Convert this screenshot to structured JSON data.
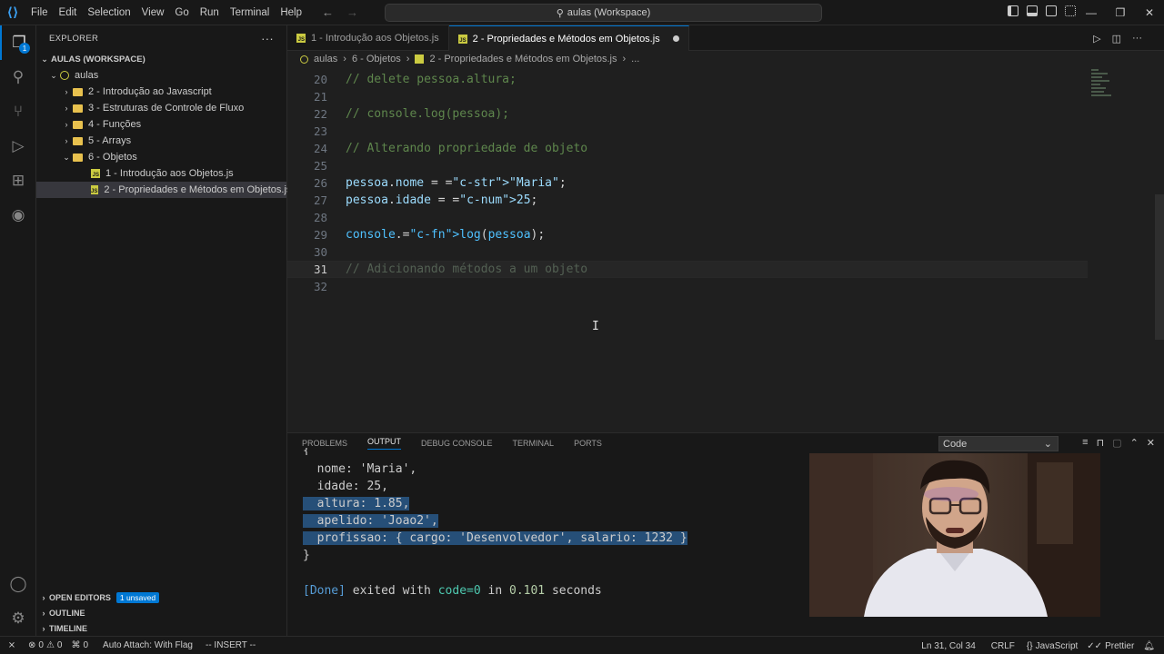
{
  "titlebar": {
    "menu": [
      "File",
      "Edit",
      "Selection",
      "View",
      "Go",
      "Run",
      "Terminal",
      "Help"
    ],
    "search_text": "aulas (Workspace)"
  },
  "sidebar": {
    "title": "EXPLORER",
    "more": "···",
    "workspace": "AULAS (WORKSPACE)",
    "root": "aulas",
    "folders": [
      "2 - Introdução ao Javascript",
      "3 - Estruturas de Controle de Fluxo",
      "4 - Funções",
      "5 - Arrays",
      "6 - Objetos"
    ],
    "files": [
      "1 - Introdução aos Objetos.js",
      "2 - Propriedades e Métodos em Objetos.js"
    ],
    "sections": {
      "open_editors": "OPEN EDITORS",
      "unsaved_badge": "1 unsaved",
      "outline": "OUTLINE",
      "timeline": "TIMELINE"
    }
  },
  "tabs": [
    {
      "label": "1 - Introdução aos Objetos.js",
      "active": false
    },
    {
      "label": "2 - Propriedades e Métodos em Objetos.js",
      "active": true
    }
  ],
  "breadcrumb": [
    "aulas",
    "6 - Objetos",
    "2 - Propriedades e Métodos em Objetos.js",
    "..."
  ],
  "editor": {
    "lines": [
      {
        "n": "20",
        "text": "// delete pessoa.altura;"
      },
      {
        "n": "21",
        "text": ""
      },
      {
        "n": "22",
        "text": "// console.log(pessoa);"
      },
      {
        "n": "23",
        "text": ""
      },
      {
        "n": "24",
        "text": "// Alterando propriedade de objeto"
      },
      {
        "n": "25",
        "text": ""
      },
      {
        "n": "26",
        "text": "pessoa.nome = \"Maria\";"
      },
      {
        "n": "27",
        "text": "pessoa.idade = 25;"
      },
      {
        "n": "28",
        "text": ""
      },
      {
        "n": "29",
        "text": "console.log(pessoa);"
      },
      {
        "n": "30",
        "text": ""
      },
      {
        "n": "31",
        "text": "// Adicionando métodos a um objeto"
      },
      {
        "n": "32",
        "text": ""
      }
    ],
    "current_line": "31"
  },
  "panel": {
    "tabs": [
      "PROBLEMS",
      "OUTPUT",
      "DEBUG CONSOLE",
      "TERMINAL",
      "PORTS"
    ],
    "active_tab": "OUTPUT",
    "channel": "Code",
    "output": {
      "open": "{",
      "nome": "  nome: 'Maria',",
      "idade": "  idade: 25,",
      "altura": "  altura: 1.85,",
      "apelido": "  apelido: 'Joao2',",
      "profissao": "  profissao: { cargo: 'Desenvolvedor', salario: 1232 }",
      "close": "}",
      "done_tag": "[Done]",
      "done_mid": " exited with ",
      "done_code": "code=0",
      "done_in": " in ",
      "done_time": "0.101",
      "done_end": " seconds"
    }
  },
  "statusbar": {
    "errors": "0",
    "warnings": "0",
    "ports": "0",
    "auto_attach": "Auto Attach: With Flag",
    "mode": "-- INSERT --",
    "position": "Ln 31, Col 34",
    "eol": "CRLF",
    "language": "JavaScript",
    "formatter": "Prettier"
  },
  "colors": {
    "accent": "#0078d4",
    "js_icon": "#cbcb41",
    "folder": "#e8c14e"
  }
}
